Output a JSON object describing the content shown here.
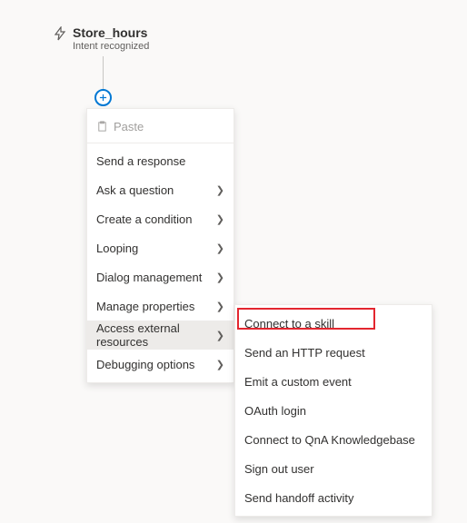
{
  "trigger": {
    "title": "Store_hours",
    "subtitle": "Intent recognized"
  },
  "paste_label": "Paste",
  "menu": {
    "items": [
      {
        "label": "Send a response",
        "has_submenu": false
      },
      {
        "label": "Ask a question",
        "has_submenu": true
      },
      {
        "label": "Create a condition",
        "has_submenu": true
      },
      {
        "label": "Looping",
        "has_submenu": true
      },
      {
        "label": "Dialog management",
        "has_submenu": true
      },
      {
        "label": "Manage properties",
        "has_submenu": true
      },
      {
        "label": "Access external resources",
        "has_submenu": true,
        "highlighted": true
      },
      {
        "label": "Debugging options",
        "has_submenu": true
      }
    ]
  },
  "submenu": {
    "items": [
      {
        "label": "Connect to a skill",
        "highlighted": true
      },
      {
        "label": "Send an HTTP request"
      },
      {
        "label": "Emit a custom event"
      },
      {
        "label": "OAuth login"
      },
      {
        "label": "Connect to QnA Knowledgebase"
      },
      {
        "label": "Sign out user"
      },
      {
        "label": "Send handoff activity"
      }
    ]
  }
}
